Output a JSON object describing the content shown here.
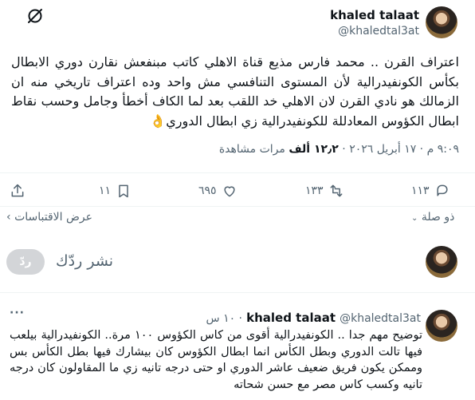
{
  "tweet": {
    "author_name": "khaled talaat",
    "author_handle": "@khaledtal3at",
    "text": "اعتراف القرن .. محمد فارس مذيع قناة الاهلي  كاتب مبنفعش نقارن دوري الابطال بكأس الكونفيدرالية لأن المستوى التنافسي مش واحد وده اعتراف تاريخي منه ان الزمالك هو نادي القرن  لان الاهلي خد اللقب بعد لما الكاف أخطأ وجامل وحسب نقاط ابطال الكؤوس المعادللة للكونفيدرالية زي ابطال الدوري👌",
    "time": "٩:٠٩ م",
    "date": "١٧ أبريل ٢٠٢٦",
    "views_count": "١٢٫٢ ألف",
    "views_label": "مرات مشاهدة",
    "actions": {
      "replies": "١١٣",
      "retweets": "١٣٣",
      "likes": "٦٩٥",
      "bookmarks": "١١"
    }
  },
  "links": {
    "quotes": "عرض الاقتباسات",
    "relevance": "ذو صلة"
  },
  "composer": {
    "placeholder": "نشر ردّك",
    "button": "ردّ"
  },
  "reply": {
    "author_name": "khaled talaat",
    "author_handle": "@khaledtal3at",
    "time_ago": "١٠ س",
    "text": "توضيح مهم جدا  .. الكونفيدرالية أقوى من كاس الكؤوس ١٠٠ مرة.. الكونفيدرالية بيلعب فيها تالت الدوري وبطل الكأس انما ابطال الكؤوس كان بيشارك فيها بطل الكأس بس وممكن يكون فريق ضعيف عاشر الدوري او حتى درجه تانيه زي ما المقاولون كان درجه تانيه وكسب كاس مصر مع حسن شحاته"
  }
}
